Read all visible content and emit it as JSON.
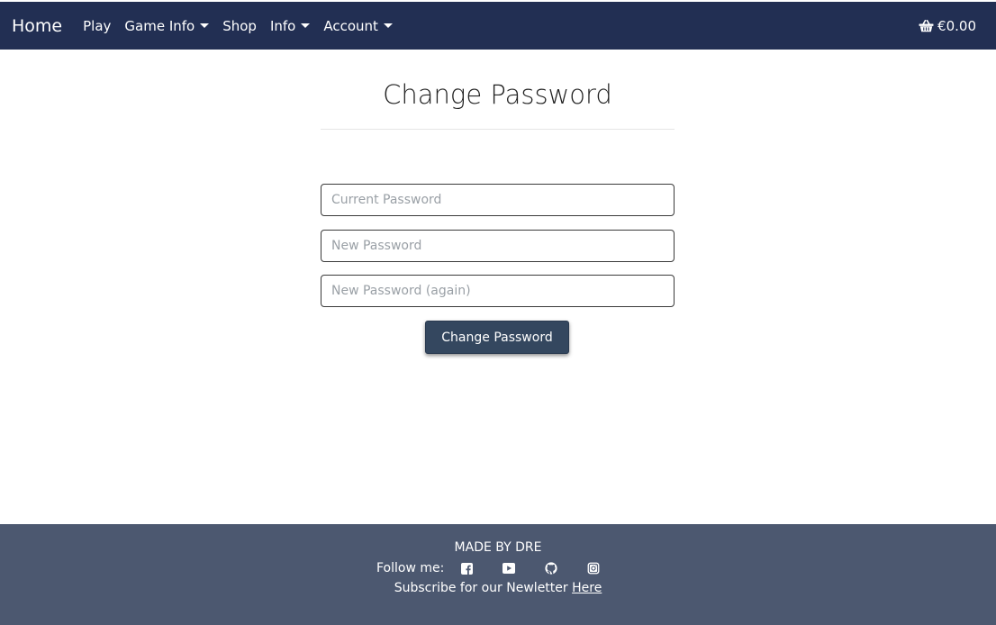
{
  "navbar": {
    "brand": "Home",
    "items": [
      {
        "label": "Play",
        "dropdown": false
      },
      {
        "label": "Game Info",
        "dropdown": true
      },
      {
        "label": "Shop",
        "dropdown": false
      },
      {
        "label": "Info",
        "dropdown": true
      },
      {
        "label": "Account",
        "dropdown": true
      }
    ],
    "cart_total": "€0.00",
    "cart_icon": "basket-icon"
  },
  "form": {
    "title": "Change Password",
    "fields": [
      {
        "placeholder": "Current Password",
        "value": ""
      },
      {
        "placeholder": "New Password",
        "value": ""
      },
      {
        "placeholder": "New Password (again)",
        "value": ""
      }
    ],
    "submit_label": "Change Password"
  },
  "footer": {
    "made_by": "MADE BY DRE",
    "follow_label": "Follow me:",
    "social_icons": [
      "facebook-icon",
      "youtube-icon",
      "github-icon",
      "instagram-icon"
    ],
    "subscribe_text": "Subscribe for our Newletter",
    "subscribe_link": "Here"
  },
  "colors": {
    "navbar_bg": "#222f53",
    "button_bg": "#34475f",
    "footer_bg": "#4c5870"
  }
}
